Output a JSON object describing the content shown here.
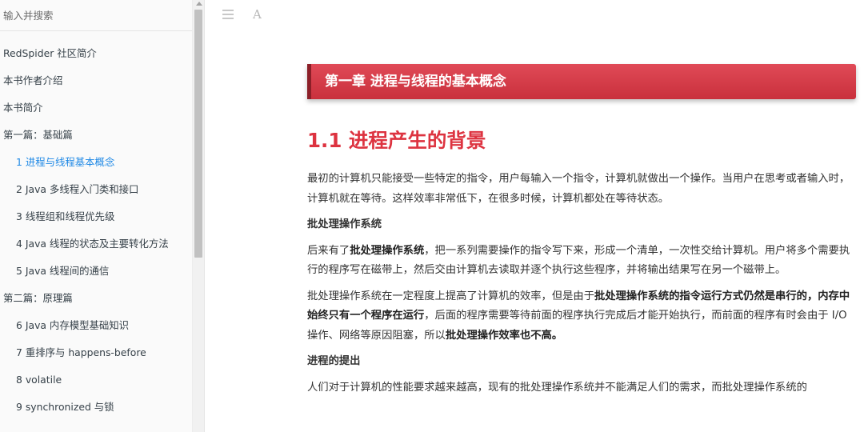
{
  "search": {
    "placeholder": "输入并搜索"
  },
  "toc": [
    {
      "label": "RedSpider 社区简介",
      "level": 0
    },
    {
      "label": "本书作者介绍",
      "level": 0
    },
    {
      "label": "本书简介",
      "level": 0
    },
    {
      "label": "第一篇：基础篇",
      "level": 0
    },
    {
      "label": "1 进程与线程基本概念",
      "level": 1,
      "active": true
    },
    {
      "label": "2 Java 多线程入门类和接口",
      "level": 1
    },
    {
      "label": "3 线程组和线程优先级",
      "level": 1
    },
    {
      "label": "4 Java 线程的状态及主要转化方法",
      "level": 1
    },
    {
      "label": "5 Java 线程间的通信",
      "level": 1
    },
    {
      "label": "第二篇：原理篇",
      "level": 0
    },
    {
      "label": "6 Java 内存模型基础知识",
      "level": 1
    },
    {
      "label": "7 重排序与 happens-before",
      "level": 1
    },
    {
      "label": "8 volatile",
      "level": 1
    },
    {
      "label": "9 synchronized 与锁",
      "level": 1
    }
  ],
  "toolbar": {
    "menu_icon": "menu-icon",
    "font_icon_label": "A"
  },
  "chapter": {
    "title": "第一章 进程与线程的基本概念"
  },
  "section": {
    "title": "1.1 进程产生的背景"
  },
  "paragraphs": {
    "p1": "最初的计算机只能接受一些特定的指令，用户每输入一个指令，计算机就做出一个操作。当用户在思考或者输入时，计算机就在等待。这样效率非常低下，在很多时候，计算机都处在等待状态。",
    "h_batch": "批处理操作系统",
    "p2_a": "后来有了",
    "p2_b": "批处理操作系统",
    "p2_c": "，把一系列需要操作的指令写下来，形成一个清单，一次性交给计算机。用户将多个需要执行的程序写在磁带上，然后交由计算机去读取并逐个执行这些程序，并将输出结果写在另一个磁带上。",
    "p3_a": "批处理操作系统在一定程度上提高了计算机的效率，但是由于",
    "p3_b": "批处理操作系统的指令运行方式仍然是串行的，内存中始终只有一个程序在运行",
    "p3_c": "，后面的程序需要等待前面的程序执行完成后才能开始执行，而前面的程序有时会由于 I/O 操作、网络等原因阻塞，所以",
    "p3_d": "批处理操作效率也不高。",
    "h_process": "进程的提出",
    "p4": "人们对于计算机的性能要求越来越高，现有的批处理操作系统并不能满足人们的需求，而批处理操作系统的"
  },
  "colors": {
    "accent": "#dd3340",
    "active_link": "#1e88e5",
    "banner": "#d43a47"
  }
}
